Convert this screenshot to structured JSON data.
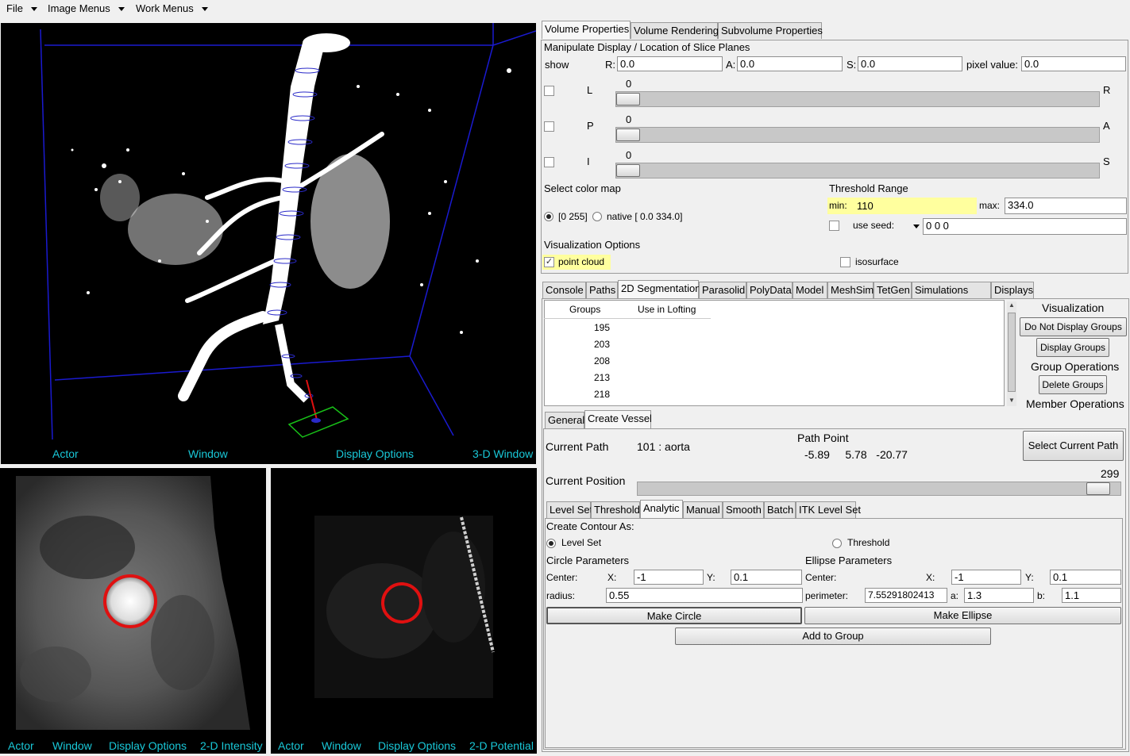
{
  "menubar": {
    "items": [
      "File",
      "Image Menus",
      "Work Menus"
    ]
  },
  "views": {
    "main3d": {
      "footer": [
        "Actor",
        "Window",
        "Display Options",
        "3-D Window"
      ]
    },
    "intensity": {
      "footer": [
        "Actor",
        "Window",
        "Display Options",
        "2-D Intensity"
      ]
    },
    "potential": {
      "footer": [
        "Actor",
        "Window",
        "Display Options",
        "2-D Potential"
      ]
    }
  },
  "top_tabs": [
    "Volume Properties",
    "Volume Rendering",
    "Subvolume Properties"
  ],
  "volume": {
    "heading": "Manipulate Display / Location of Slice Planes",
    "show_label": "show",
    "r_label": "R:",
    "r_value": "0.0",
    "a_label": "A:",
    "a_value": "0.0",
    "s_label": "S:",
    "s_value": "0.0",
    "pixel_label": "pixel value:",
    "pixel_value": "0.0",
    "sliders": [
      {
        "left": "L",
        "right": "R",
        "value": "0"
      },
      {
        "left": "P",
        "right": "A",
        "value": "0"
      },
      {
        "left": "I",
        "right": "S",
        "value": "0"
      }
    ],
    "colormap_label": "Select color map",
    "cm_option1": "[0 255]",
    "cm_option2": "native [ 0.0 334.0]",
    "threshold_label": "Threshold Range",
    "min_label": "min:",
    "min_value": "110",
    "max_label": "max:",
    "max_value": "334.0",
    "use_seed_label": "use seed:",
    "seed_value": "0 0 0",
    "vis_label": "Visualization Options",
    "point_cloud": "point cloud",
    "isosurface": "isosurface"
  },
  "mid_tabs": [
    "Console",
    "Paths",
    "2D Segmentation",
    "Parasolid",
    "PolyData",
    "Model",
    "MeshSim",
    "TetGen",
    "Simulations",
    "Displays"
  ],
  "groups": {
    "col_groups": "Groups",
    "col_lofting": "Use in Lofting",
    "rows": [
      "195",
      "203",
      "208",
      "213",
      "218"
    ],
    "vis_heading": "Visualization",
    "btn_no_display": "Do Not Display Groups",
    "btn_display": "Display Groups",
    "group_ops": "Group Operations",
    "btn_delete": "Delete Groups",
    "member_ops": "Member Operations"
  },
  "sub_tabs": [
    "General",
    "Create Vessel"
  ],
  "vessel": {
    "current_path_label": "Current Path",
    "current_path_value": "101 : aorta",
    "path_point_label": "Path Point",
    "path_point_value": "-5.89     5.78   -20.77",
    "select_path_btn": "Select Current Path",
    "current_position_label": "Current Position",
    "position_value": "299",
    "position_fraction": 0.98
  },
  "method_tabs": [
    "Level Set",
    "Threshold",
    "Analytic",
    "Manual",
    "Smooth",
    "Batch",
    "ITK Level Set"
  ],
  "analytic": {
    "create_as": "Create Contour As:",
    "opt_levelset": "Level Set",
    "opt_threshold": "Threshold",
    "circle_heading": "Circle Parameters",
    "ellipse_heading": "Ellipse Parameters",
    "center_label": "Center:",
    "x_label": "X:",
    "y_label": "Y:",
    "circle_x": "-1",
    "circle_y": "0.1",
    "radius_label": "radius:",
    "radius_value": "0.55",
    "ellipse_x": "-1",
    "ellipse_y": "0.1",
    "perimeter_label": "perimeter:",
    "perimeter_value": "7.55291802413",
    "a_label": "a:",
    "a_value": "1.3",
    "b_label": "b:",
    "b_value": "1.1",
    "make_circle": "Make Circle",
    "make_ellipse": "Make Ellipse",
    "add_to_group": "Add to Group"
  },
  "colors": {
    "accent_cyan": "#19c8d8",
    "highlight_yellow": "#ffff9e",
    "contour_red": "#e01010",
    "bbox_blue": "#1a1ad0"
  }
}
